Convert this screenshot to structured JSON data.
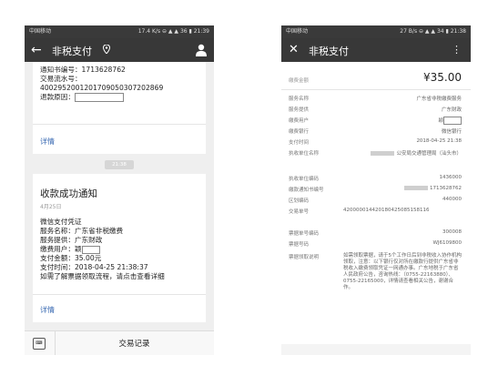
{
  "left": {
    "status": {
      "carrier": "中国移动",
      "right": "17.4 K/s  ⊖ ▲ ▲ 36 ▮ 21:39"
    },
    "title": "非税支付",
    "card1": {
      "lines": [
        "通知书编号：1713628762",
        "交易流水号：",
        "4002952001201709050307202869",
        "退款原因："
      ],
      "detail": "详情"
    },
    "time_chip": "21:38",
    "card2": {
      "title": "收款成功通知",
      "date": "4月25日",
      "lines": [
        "微信支付凭证",
        "服务名称：广东省非税缴费",
        "服务提供：广东财政",
        "缴费用户：",
        "支付金额：35.00元",
        "支付时间：2018-04-25 21:38:37",
        "如需了解票据领取流程，请点击查看详细"
      ],
      "user_suffix": "颖",
      "detail": "详情"
    },
    "bottom_label": "交易记录",
    "keyboard_label": "⌨"
  },
  "right": {
    "status": {
      "carrier": "中国移动",
      "right": "27 B/s ⊖ ▲ ▲ 34 ▮ 21:38"
    },
    "title": "非税支付",
    "amount_label": "缴费金额",
    "amount": "¥35.00",
    "rows": [
      {
        "k": "服务名称",
        "v": "广东省非税缴费服务"
      },
      {
        "k": "服务提供",
        "v": "广东财政"
      },
      {
        "k": "缴费用户",
        "v": "颖"
      },
      {
        "k": "缴费银行",
        "v": "微信银行"
      },
      {
        "k": "支付时间",
        "v": "2018-04-25 21:38"
      },
      {
        "k": "执收单位名称",
        "v": "公安局交通管理局（汕头市）"
      },
      {
        "k": "执收单位编码",
        "v": "1436000"
      },
      {
        "k": "缴款通知书编号",
        "v": "1713628762"
      },
      {
        "k": "区划编码",
        "v": "440000"
      },
      {
        "k": "交易单号",
        "v": "420000014420180425085158116"
      },
      {
        "k": "票据单号编码",
        "v": "300008"
      },
      {
        "k": "票据号码",
        "v": "WJ6109800"
      },
      {
        "k": "票据领取说明",
        "v": "如需领取票据，请于5个工作日后到非税收入协作机构领取，注意：以下银行仅对所在缴款行提供广东省非税收入缴费领取凭证一网通办事。广东地税于广东省人民政府公告，咨询热线：（0755-22163880）、0755-22165000，详情请查看相关公告，谢谢合作。"
      }
    ]
  }
}
